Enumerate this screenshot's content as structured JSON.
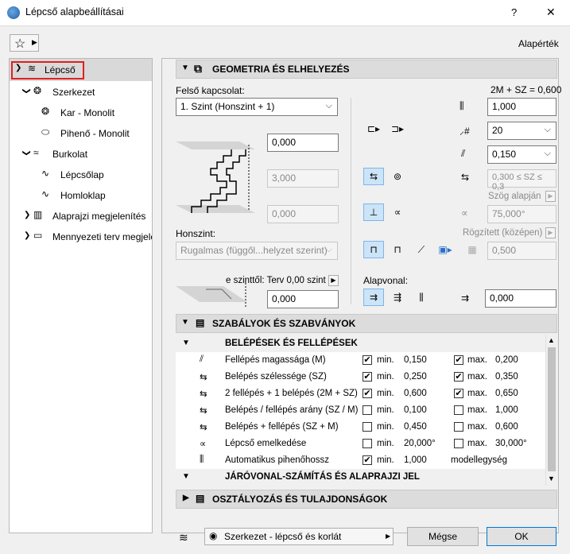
{
  "window": {
    "title": "Lépcső alapbeállításai",
    "help": "?",
    "close": "✕"
  },
  "toolbar": {
    "default_label": "Alapérték"
  },
  "tree": {
    "items": [
      {
        "label": "Lépcső"
      },
      {
        "label": "Szerkezet"
      },
      {
        "label": "Kar - Monolit"
      },
      {
        "label": "Pihenő - Monolit"
      },
      {
        "label": "Burkolat"
      },
      {
        "label": "Lépcsőlap"
      },
      {
        "label": "Homloklap"
      },
      {
        "label": "Alaprajzi megjelenítés"
      },
      {
        "label": "Mennyezeti terv megjelenítés"
      }
    ]
  },
  "geometry": {
    "header": "GEOMETRIA ÉS ELHELYEZÉS",
    "formula": "2M + SZ = 0,600",
    "top_connection_label": "Felső kapcsolat:",
    "top_connection_value": "1. Szint (Honszint + 1)",
    "top_offset": "0,000",
    "height_value": "3,000",
    "bottom_offset": "0,000",
    "home_story_label": "Honszint:",
    "home_story_value": "Rugalmas (függől...helyzet szerint)",
    "from_story_label": "e szinttől: Terv 0,00 szint",
    "from_story_value": "0,000",
    "width_value": "1,000",
    "riser_count": "20",
    "riser_height": "0,150",
    "tread_range": "0,300 ≤ SZ ≤ 0,3",
    "angle_label": "Szög alapján",
    "angle_value": "75,000°",
    "fixed_label": "Rögzített (középen)",
    "fixed_value": "0,500",
    "baseline_label": "Alapvonal:",
    "baseline_value": "0,000"
  },
  "rules": {
    "header": "SZABÁLYOK ÉS SZABVÁNYOK",
    "group1": "BELÉPÉSEK ÉS FELLÉPÉSEK",
    "rows": [
      {
        "label": "Fellépés magassága (M)",
        "min_checked": true,
        "min": "0,150",
        "max_checked": true,
        "max": "0,200"
      },
      {
        "label": "Belépés szélessége (SZ)",
        "min_checked": true,
        "min": "0,250",
        "max_checked": true,
        "max": "0,350"
      },
      {
        "label": "2 fellépés + 1 belépés (2M + SZ)",
        "min_checked": true,
        "min": "0,600",
        "max_checked": true,
        "max": "0,650"
      },
      {
        "label": "Belépés / fellépés arány (SZ / M)",
        "min_checked": false,
        "min": "0,100",
        "max_checked": false,
        "max": "1,000"
      },
      {
        "label": "Belépés + fellépés (SZ + M)",
        "min_checked": false,
        "min": "0,450",
        "max_checked": false,
        "max": "0,600"
      },
      {
        "label": "Lépcső emelkedése",
        "min_checked": false,
        "min": "20,000°",
        "max_checked": false,
        "max": "30,000°"
      },
      {
        "label": "Automatikus pihenőhossz",
        "min_checked": true,
        "min": "1,000",
        "max_checked": false,
        "max": "modellegység"
      }
    ],
    "min_label": "min.",
    "max_label": "max.",
    "group2": "JÁRÓVONAL-SZÁMÍTÁS ÉS ALAPRAJZI JEL"
  },
  "classification": {
    "header": "OSZTÁLYOZÁS ÉS TULAJDONSÁGOK"
  },
  "footer": {
    "layer_value": "Szerkezet - lépcső és korlát",
    "cancel": "Mégse",
    "ok": "OK"
  }
}
